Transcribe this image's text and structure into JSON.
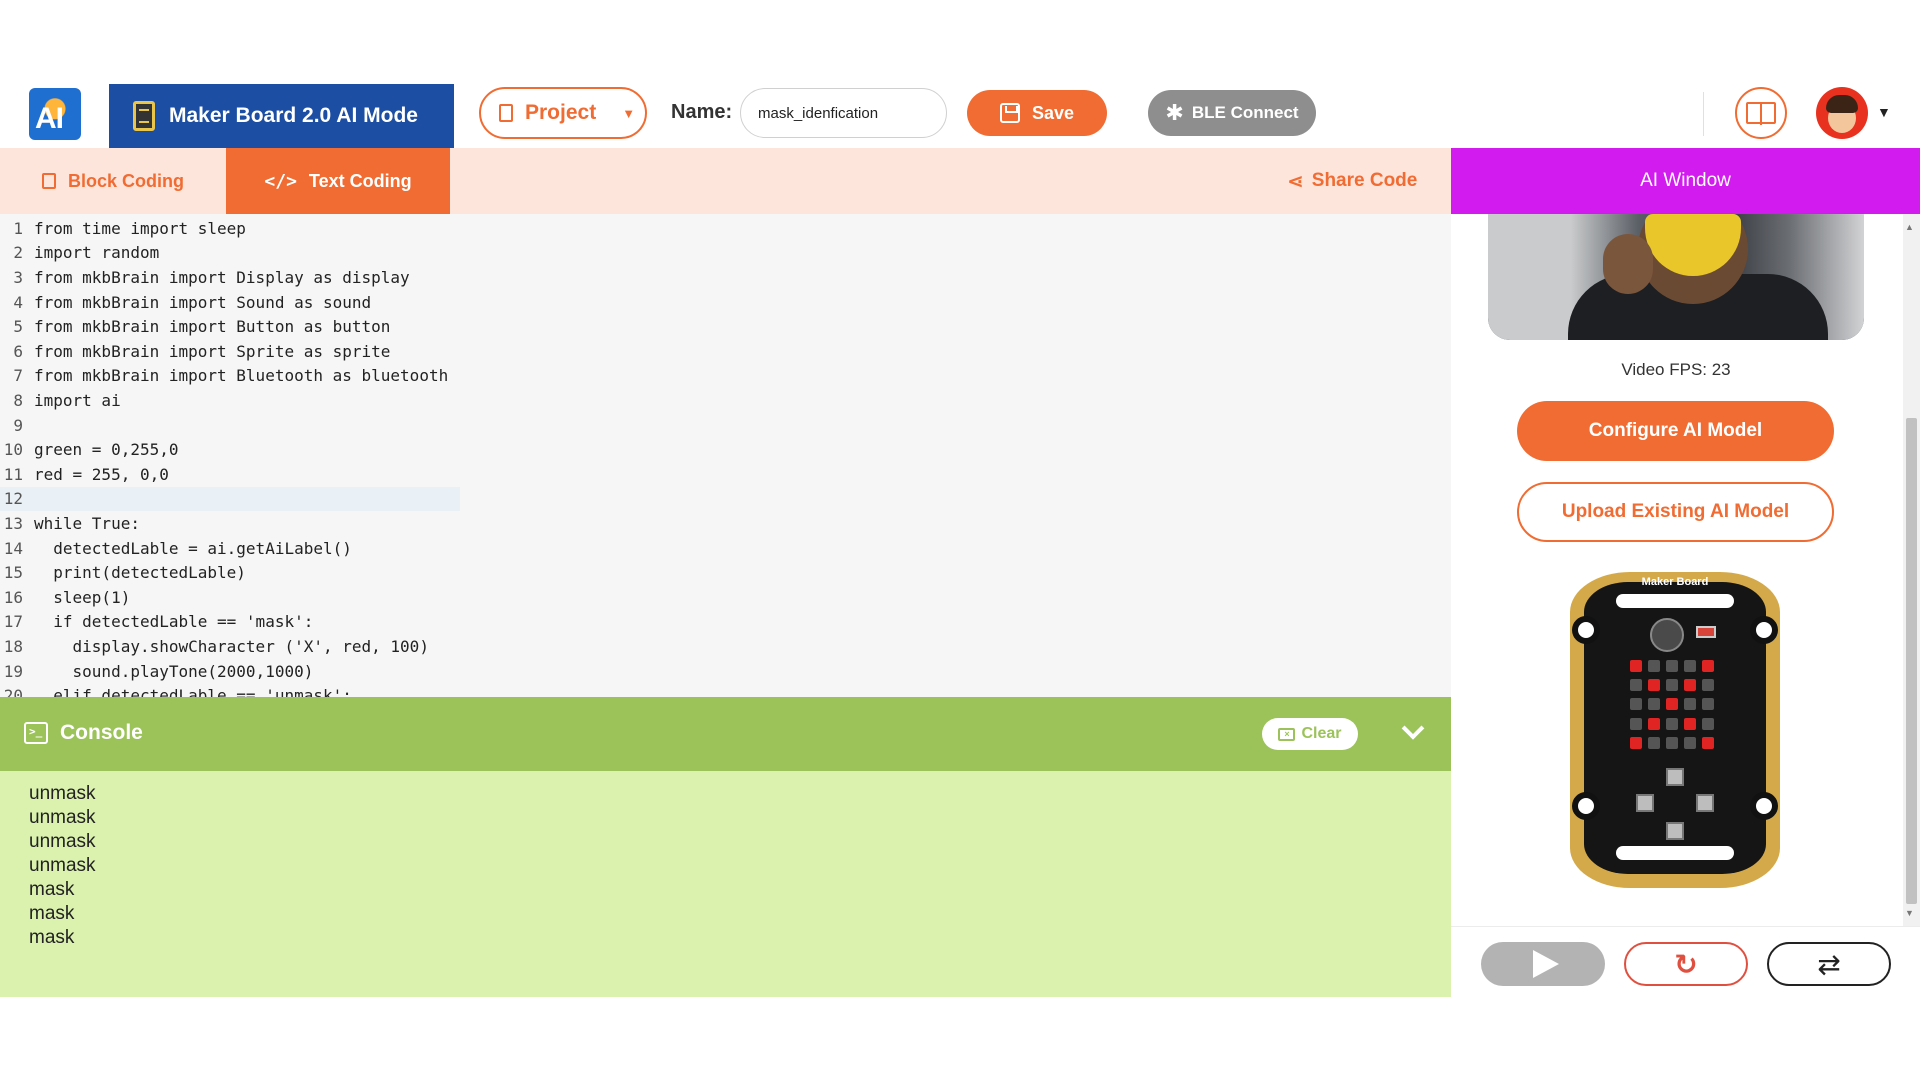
{
  "header": {
    "board_title": "Maker Board 2.0 AI Mode",
    "project_label": "Project",
    "name_label": "Name:",
    "name_value": "mask_idenfication",
    "save_label": "Save",
    "ble_label": "BLE Connect"
  },
  "tabs": {
    "block": "Block Coding",
    "text": "Text Coding",
    "share": "Share Code"
  },
  "code_lines": [
    {
      "n": "1",
      "text": "from time import sleep"
    },
    {
      "n": "2",
      "text": "import random"
    },
    {
      "n": "3",
      "text": "from mkbBrain import Display as display"
    },
    {
      "n": "4",
      "text": "from mkbBrain import Sound as sound"
    },
    {
      "n": "5",
      "text": "from mkbBrain import Button as button"
    },
    {
      "n": "6",
      "text": "from mkbBrain import Sprite as sprite"
    },
    {
      "n": "7",
      "text": "from mkbBrain import Bluetooth as bluetooth"
    },
    {
      "n": "8",
      "text": "import ai"
    },
    {
      "n": "9",
      "text": ""
    },
    {
      "n": "10",
      "text": "green = 0,255,0"
    },
    {
      "n": "11",
      "text": "red = 255, 0,0"
    },
    {
      "n": "12",
      "text": ""
    },
    {
      "n": "13",
      "text": "while True:"
    },
    {
      "n": "14",
      "text": "  detectedLable = ai.getAiLabel()"
    },
    {
      "n": "15",
      "text": "  print(detectedLable)"
    },
    {
      "n": "16",
      "text": "  sleep(1)"
    },
    {
      "n": "17",
      "text": "  if detectedLable == 'mask':"
    },
    {
      "n": "18",
      "text": "    display.showCharacter ('X', red, 100)"
    },
    {
      "n": "19",
      "text": "    sound.playTone(2000,1000)"
    },
    {
      "n": "20",
      "text": "  elif detectedLable == 'unmask':"
    }
  ],
  "console": {
    "title": "Console",
    "clear_label": "Clear",
    "output": [
      "unmask",
      "unmask",
      "unmask",
      "unmask",
      "mask",
      "mask",
      "mask"
    ]
  },
  "ai_window": {
    "title": "AI Window",
    "fps_text": "Video FPS: 23",
    "configure_label": "Configure AI Model",
    "upload_label": "Upload Existing AI Model",
    "board_label": "Maker Board"
  },
  "led_matrix": [
    [
      1,
      0,
      0,
      0,
      1
    ],
    [
      0,
      1,
      0,
      1,
      0
    ],
    [
      0,
      0,
      1,
      0,
      0
    ],
    [
      0,
      1,
      0,
      1,
      0
    ],
    [
      1,
      0,
      0,
      0,
      1
    ]
  ],
  "colors": {
    "accent": "#f06c32",
    "board_title_bg": "#1c4ea3",
    "ai_window_bg": "#d11bef",
    "console_bar": "#9cc35a",
    "console_output_bg": "#dbf2af"
  },
  "icons": {
    "logo": "ai-logo-icon",
    "save": "floppy-disk-icon",
    "ble": "bluetooth-icon",
    "guide": "book-icon",
    "share": "share-icon",
    "run": "play-icon",
    "reset": "reset-icon",
    "sync": "sync-icon",
    "collapse": "chevron-down-icon"
  }
}
